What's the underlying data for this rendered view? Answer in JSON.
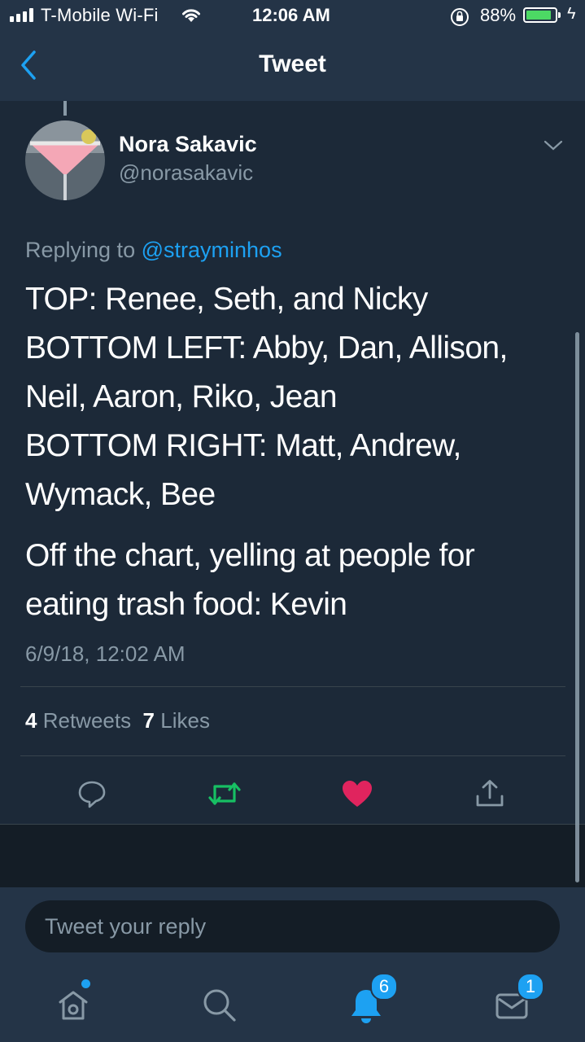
{
  "status_bar": {
    "carrier": "T-Mobile Wi-Fi",
    "time": "12:06 AM",
    "battery_percent": "88%",
    "battery_level": 0.88
  },
  "nav": {
    "title": "Tweet",
    "back_icon": "chevron-left-icon"
  },
  "tweet": {
    "author_name": "Nora Sakavic",
    "author_handle": "@norasakavic",
    "replying_prefix": "Replying to",
    "replying_to": "@strayminhos",
    "lines": [
      "TOP: Renee, Seth, and Nicky",
      "BOTTOM LEFT: Abby, Dan, Allison,",
      "Neil, Aaron, Riko, Jean",
      "BOTTOM RIGHT: Matt, Andrew,",
      "Wymack, Bee"
    ],
    "lines2": [
      "Off the chart, yelling at people for",
      "eating trash food: Kevin"
    ],
    "timestamp": "6/9/18, 12:02 AM",
    "retweet_count": "4",
    "retweet_label": "Retweets",
    "like_count": "7",
    "like_label": "Likes"
  },
  "actions": {
    "reply_icon": "reply-icon",
    "retweet_icon": "retweet-icon",
    "like_icon": "heart-icon",
    "share_icon": "share-icon"
  },
  "reply_box": {
    "placeholder": "Tweet your reply"
  },
  "tab_bar": {
    "notifications_badge": "6",
    "messages_badge": "1"
  },
  "colors": {
    "background": "#1c2938",
    "bar": "#243447",
    "accent": "#1da1f2",
    "retweet_active": "#17bf63",
    "like_active": "#e0245e",
    "secondary_text": "#8899a6"
  }
}
